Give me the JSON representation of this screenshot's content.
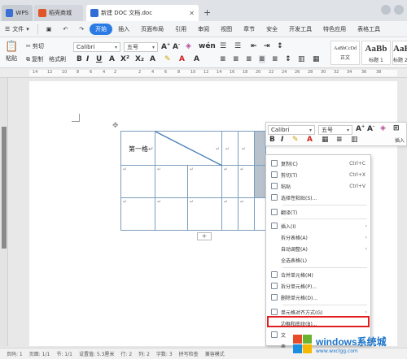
{
  "tabs": {
    "wps": "WPS",
    "mall": "稻壳商城",
    "doc": "新建 DOC 文档.doc",
    "new_tab": "+"
  },
  "menu": {
    "file": "文件",
    "items": [
      "开始",
      "插入",
      "页面布局",
      "引用",
      "审阅",
      "视图",
      "章节",
      "安全",
      "开发工具",
      "特色应用",
      "表格工具"
    ],
    "active_index": 0
  },
  "ribbon": {
    "paste": "粘贴",
    "cut": "剪切",
    "copy": "复制",
    "format_painter": "格式刷",
    "font": "Calibri",
    "size": "五号",
    "styles": [
      {
        "preview": "AaBbCcDd",
        "label": "正文"
      },
      {
        "preview": "AaBb",
        "label": "标题 1"
      },
      {
        "preview": "AaBt",
        "label": "标题 2"
      }
    ]
  },
  "ruler": {
    "numbers": [
      "14",
      "12",
      "10",
      "8",
      "6",
      "4",
      "2",
      "2",
      "4",
      "6",
      "8",
      "10",
      "12",
      "14",
      "16",
      "18",
      "20",
      "22",
      "24",
      "26",
      "28",
      "30",
      "32",
      "34",
      "36",
      "38"
    ]
  },
  "table": {
    "first_cell": "第一格",
    "para_mark": "↵"
  },
  "mini_toolbar": {
    "font": "Calibri",
    "size": "五号",
    "insert": "插入"
  },
  "context_menu": {
    "items": [
      {
        "label": "复制(C)",
        "shortcut": "Ctrl+C"
      },
      {
        "label": "剪切(T)",
        "shortcut": "Ctrl+X"
      },
      {
        "label": "粘贴",
        "shortcut": "Ctrl+V"
      },
      {
        "label": "选择性粘贴(S)...",
        "shortcut": ""
      },
      {
        "label": "翻译(T)",
        "shortcut": ""
      },
      {
        "label": "插入(I)",
        "shortcut": ""
      },
      {
        "label": "拆分表格(A)",
        "shortcut": ""
      },
      {
        "label": "自动调整(A)",
        "shortcut": ""
      },
      {
        "label": "全选表格(L)",
        "shortcut": ""
      },
      {
        "label": "合并单元格(M)",
        "shortcut": ""
      },
      {
        "label": "拆分单元格(P)...",
        "shortcut": ""
      },
      {
        "label": "删除单元格(D)...",
        "shortcut": ""
      },
      {
        "label": "单元格对齐方式(G)",
        "shortcut": ""
      },
      {
        "label": "边框和底纹(B)...",
        "shortcut": ""
      },
      {
        "label": "文",
        "shortcut": ""
      },
      {
        "label": "表",
        "shortcut": ""
      }
    ]
  },
  "watermark": {
    "title": "windows系统城",
    "url": "www.wxclgg.com"
  },
  "status_bar": {
    "items": [
      "页码: 1",
      "页面: 1/1",
      "节: 1/1",
      "设置值: 5.3厘米",
      "行: 2",
      "列: 2",
      "字数: 3",
      "拼写检查",
      "兼容模式"
    ]
  },
  "colors": {
    "accent": "#2b7be4",
    "highlight": "#e02020",
    "selected_cell": "#b7c2cd",
    "table_border": "#7a9ebf"
  }
}
